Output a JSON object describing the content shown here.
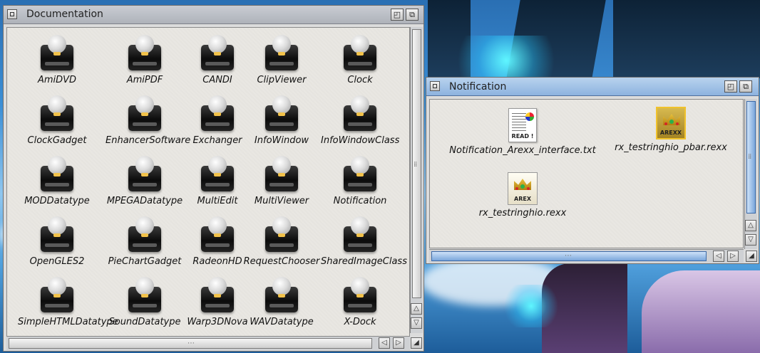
{
  "desktop": {
    "background": "#3c8fd6"
  },
  "doc_window": {
    "title": "Documentation",
    "icons": [
      "AmiDVD",
      "AmiPDF",
      "CANDI",
      "ClipViewer",
      "Clock",
      "ClockGadget",
      "EnhancerSoftware",
      "Exchanger",
      "InfoWindow",
      "InfoWindowClass",
      "MODDatatype",
      "MPEGADatatype",
      "MultiEdit",
      "MultiViewer",
      "Notification",
      "OpenGLES2",
      "PieChartGadget",
      "RadeonHD",
      "RequestChooser",
      "SharedImageClass",
      "SimpleHTMLDatatype",
      "SoundDatatype",
      "Warp3DNova",
      "WAVDatatype",
      "X-Dock"
    ]
  },
  "notif_window": {
    "title": "Notification",
    "icons": [
      {
        "label": "Notification_Arexx_interface.txt",
        "icon": "readme-doc-icon",
        "tag": "READ !"
      },
      {
        "label": "rx_testringhio_pbar.rexx",
        "icon": "arexx-script-icon",
        "tag": "AREXX",
        "selected": true
      },
      {
        "label": "rx_testringhio.rexx",
        "icon": "arexx-script-icon",
        "tag": "AREX"
      }
    ]
  },
  "colors": {
    "active_title": "#8db3df",
    "inactive_title": "#aeb2ba",
    "selection": "#f0c22c"
  }
}
